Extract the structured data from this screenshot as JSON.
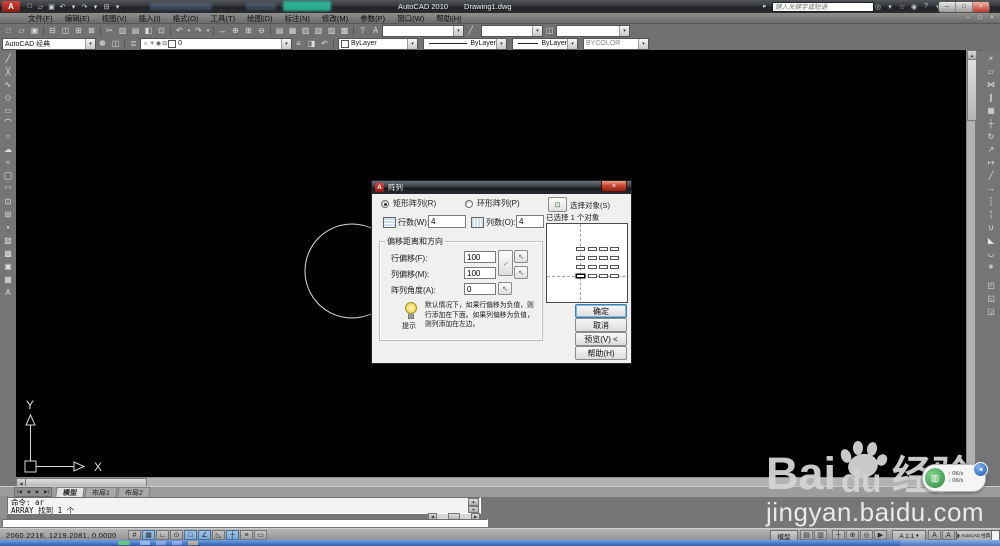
{
  "icons": {
    "combo_arrow": "▾",
    "expand": "▸",
    "up": "▲",
    "down": "▼",
    "left": "◀",
    "right": "▶",
    "acad_mini": "A",
    "pick": "↖",
    "pick_both": "↔",
    "select_objects": "⊡",
    "net_drum": "▥",
    "net_badge": "◄",
    "gear": "☸",
    "ui_icon": "◫",
    "layer_mgr": "≣"
  },
  "titlebar": {
    "logo": "A",
    "app_title": "AutoCAD 2010",
    "doc_title": "Drawing1.dwg",
    "search_placeholder": "键入关键字或短语",
    "qat_icons": [
      {
        "name": "new-icon",
        "glyph": "□"
      },
      {
        "name": "open-icon",
        "glyph": "▱"
      },
      {
        "name": "save-icon",
        "glyph": "▣"
      },
      {
        "name": "undo-icon",
        "glyph": "↶"
      },
      {
        "name": "undo-caret-icon",
        "glyph": "▾"
      },
      {
        "name": "redo-icon",
        "glyph": "↷"
      },
      {
        "name": "redo-caret-icon",
        "glyph": "▾"
      },
      {
        "name": "plot-icon",
        "glyph": "⊟"
      },
      {
        "name": "qat-caret-icon",
        "glyph": "▾"
      }
    ],
    "infocenter_icons": [
      {
        "name": "binoculars-icon",
        "glyph": "◎"
      },
      {
        "name": "search-caret-icon",
        "glyph": "▾"
      },
      {
        "name": "subscription-icon",
        "glyph": "☆"
      },
      {
        "name": "communication-icon",
        "glyph": "◉"
      },
      {
        "name": "help-icon",
        "glyph": "?"
      },
      {
        "name": "help-caret-icon",
        "glyph": "▾"
      }
    ],
    "window_buttons": [
      {
        "name": "minimize-button",
        "glyph": "─"
      },
      {
        "name": "restore-button",
        "glyph": "□"
      },
      {
        "name": "close-button",
        "glyph": "×"
      }
    ]
  },
  "menubar": {
    "items": [
      "文件(F)",
      "编辑(E)",
      "视图(V)",
      "插入(I)",
      "格式(O)",
      "工具(T)",
      "绘图(D)",
      "标注(N)",
      "修改(M)",
      "参数(P)",
      "窗口(W)",
      "帮助(H)"
    ],
    "doc_buttons": [
      {
        "name": "doc-minimize-button",
        "glyph": "─"
      },
      {
        "name": "doc-restore-button",
        "glyph": "□"
      },
      {
        "name": "doc-close-button",
        "glyph": "×"
      }
    ]
  },
  "toolbar1": {
    "icons": [
      {
        "name": "new-icon",
        "glyph": "□"
      },
      {
        "name": "open-icon",
        "glyph": "▱"
      },
      {
        "name": "save-icon",
        "glyph": "▣"
      },
      {
        "name": "separator",
        "glyph": "",
        "cls": "sepi",
        "inter": "false"
      },
      {
        "name": "plot-icon",
        "glyph": "⊟"
      },
      {
        "name": "plot-preview-icon",
        "glyph": "◫"
      },
      {
        "name": "publish-icon",
        "glyph": "⊞"
      },
      {
        "name": "export-dwf-icon",
        "glyph": "⊠"
      },
      {
        "name": "separator",
        "glyph": "",
        "cls": "sepi",
        "inter": "false"
      },
      {
        "name": "cut-icon",
        "glyph": "✂"
      },
      {
        "name": "copy-icon",
        "glyph": "▥"
      },
      {
        "name": "paste-icon",
        "glyph": "▤"
      },
      {
        "name": "match-properties-icon",
        "glyph": "◧"
      },
      {
        "name": "block-editor-icon",
        "glyph": "⊡"
      },
      {
        "name": "separator",
        "glyph": "",
        "cls": "sepi",
        "inter": "false"
      },
      {
        "name": "undo-icon",
        "glyph": "↶"
      },
      {
        "name": "undo-caret-icon",
        "glyph": "▾",
        "cls": "narrow"
      },
      {
        "name": "redo-icon",
        "glyph": "↷"
      },
      {
        "name": "redo-caret-icon",
        "glyph": "▾",
        "cls": "narrow"
      },
      {
        "name": "separator",
        "glyph": "",
        "cls": "sepi",
        "inter": "false"
      },
      {
        "name": "pan-icon",
        "glyph": "↔"
      },
      {
        "name": "zoom-realtime-icon",
        "glyph": "⊕"
      },
      {
        "name": "zoom-window-icon",
        "glyph": "⊞"
      },
      {
        "name": "zoom-previous-icon",
        "glyph": "⊖"
      },
      {
        "name": "separator",
        "glyph": "",
        "cls": "sepi",
        "inter": "false"
      },
      {
        "name": "properties-icon",
        "glyph": "▤"
      },
      {
        "name": "designcenter-icon",
        "glyph": "▦"
      },
      {
        "name": "tool-palettes-icon",
        "glyph": "▥"
      },
      {
        "name": "sheet-set-manager-icon",
        "glyph": "▧"
      },
      {
        "name": "markup-icon",
        "glyph": "▨"
      },
      {
        "name": "quickcalc-icon",
        "glyph": "▩"
      },
      {
        "name": "separator",
        "glyph": "",
        "cls": "sepi",
        "inter": "false"
      },
      {
        "name": "help-icon",
        "glyph": "?"
      }
    ],
    "style_icon": "A",
    "brush_icon": "╱"
  },
  "toolbar2": {
    "workspace_value": "AutoCAD 经典",
    "layer_icons": [
      {
        "name": "layer-on-icon",
        "glyph": "☼"
      },
      {
        "name": "layer-freeze-icon",
        "glyph": "☀"
      },
      {
        "name": "layer-lock-icon",
        "glyph": "◉"
      },
      {
        "name": "layer-plot-icon",
        "glyph": "⊟"
      }
    ],
    "layer_value": "0",
    "layer_tool_icons": [
      {
        "name": "layer-states-icon",
        "glyph": "≡"
      },
      {
        "name": "make-layer-current-icon",
        "glyph": "◨"
      },
      {
        "name": "layer-previous-icon",
        "glyph": "↶"
      }
    ],
    "color_value": "ByLayer",
    "linetype_value": "ByLayer",
    "lineweight_value": "ByLayer",
    "plotstyle_value": "BYCOLOR"
  },
  "draw_toolbar": [
    {
      "name": "line-icon",
      "glyph": "╱"
    },
    {
      "name": "construction-line-icon",
      "glyph": "╳"
    },
    {
      "name": "polyline-icon",
      "glyph": "∿"
    },
    {
      "name": "polygon-icon",
      "glyph": "◇"
    },
    {
      "name": "rectangle-icon",
      "glyph": "▭"
    },
    {
      "name": "arc-icon",
      "glyph": "⌒"
    },
    {
      "name": "circle-icon",
      "glyph": "○"
    },
    {
      "name": "revision-cloud-icon",
      "glyph": "☁"
    },
    {
      "name": "spline-icon",
      "glyph": "≈"
    },
    {
      "name": "ellipse-icon",
      "glyph": "◯"
    },
    {
      "name": "ellipse-arc-icon",
      "glyph": "◠"
    },
    {
      "name": "insert-block-icon",
      "glyph": "⊡"
    },
    {
      "name": "make-block-icon",
      "glyph": "⊞"
    },
    {
      "name": "point-icon",
      "glyph": "•"
    },
    {
      "name": "hatch-icon",
      "glyph": "▨"
    },
    {
      "name": "gradient-icon",
      "glyph": "▩"
    },
    {
      "name": "region-icon",
      "glyph": "▣"
    },
    {
      "name": "table-icon",
      "glyph": "▦"
    },
    {
      "name": "mtext-icon",
      "glyph": "A"
    }
  ],
  "modify_toolbar": [
    {
      "name": "erase-icon",
      "glyph": "×"
    },
    {
      "name": "copy-icon",
      "glyph": "▱"
    },
    {
      "name": "mirror-icon",
      "glyph": "⋈"
    },
    {
      "name": "offset-icon",
      "glyph": "∥"
    },
    {
      "name": "array-icon",
      "glyph": "▦"
    },
    {
      "name": "move-icon",
      "glyph": "┼"
    },
    {
      "name": "rotate-icon",
      "glyph": "↻"
    },
    {
      "name": "scale-icon",
      "glyph": "↗"
    },
    {
      "name": "stretch-icon",
      "glyph": "↦"
    },
    {
      "name": "trim-icon",
      "glyph": "╱"
    },
    {
      "name": "extend-icon",
      "glyph": "→"
    },
    {
      "name": "break-at-point-icon",
      "glyph": "┆"
    },
    {
      "name": "break-icon",
      "glyph": "╎"
    },
    {
      "name": "join-icon",
      "glyph": "∪"
    },
    {
      "name": "chamfer-icon",
      "glyph": "◣"
    },
    {
      "name": "fillet-icon",
      "glyph": "◡"
    },
    {
      "name": "explode-icon",
      "glyph": "∗"
    }
  ],
  "draworder_toolbar": [
    {
      "name": "bring-to-front-icon",
      "glyph": "◰"
    },
    {
      "name": "send-to-back-icon",
      "glyph": "◱"
    },
    {
      "name": "bring-above-icon",
      "glyph": "◲"
    }
  ],
  "dialog": {
    "title": "阵列",
    "radio_rect": "矩形阵列(R)",
    "radio_polar": "环形阵列(P)",
    "rows_label": "行数(W):",
    "rows_value": "4",
    "cols_label": "列数(O):",
    "cols_value": "4",
    "group_title": "偏移距离和方向",
    "row_offset_label": "行偏移(F):",
    "row_offset_value": "100",
    "col_offset_label": "列偏移(M):",
    "col_offset_value": "100",
    "angle_label": "阵列角度(A):",
    "angle_value": "0",
    "tip_label": "提示",
    "tip_text": "默认情况下，如果行偏移为负值，则行添加在下面。如果列偏移为负值，则列添加在左边。",
    "select_objects_label": "选择对象(S)",
    "selected_info": "已选择 1 个对象",
    "btn_ok": "确定",
    "btn_cancel": "取消",
    "btn_preview": "预览(V) <",
    "btn_help": "帮助(H)"
  },
  "ucs": {
    "x_label": "X",
    "y_label": "Y"
  },
  "tabs": {
    "nav": [
      {
        "name": "first-tab-button",
        "glyph": "|◀"
      },
      {
        "name": "prev-tab-button",
        "glyph": "◀"
      },
      {
        "name": "next-tab-button",
        "glyph": "▶"
      },
      {
        "name": "last-tab-button",
        "glyph": "▶|"
      }
    ],
    "items": [
      {
        "label": "模型",
        "cls": "active"
      },
      {
        "label": "布局1",
        "cls": ""
      },
      {
        "label": "布局2",
        "cls": ""
      }
    ]
  },
  "command": {
    "lines": [
      "命令: ar",
      "ARRAY 找到 1 个"
    ]
  },
  "statusbar": {
    "coords": "2060.2216, 1219.2081, 0.0000",
    "toggles": [
      {
        "name": "snap-toggle",
        "glyph": "#",
        "cls": ""
      },
      {
        "name": "grid-toggle",
        "glyph": "▦",
        "cls": "on"
      },
      {
        "name": "ortho-toggle",
        "glyph": "∟",
        "cls": ""
      },
      {
        "name": "polar-toggle",
        "glyph": "⊙",
        "cls": ""
      },
      {
        "name": "osnap-toggle",
        "glyph": "□",
        "cls": "on"
      },
      {
        "name": "otrack-toggle",
        "glyph": "∠",
        "cls": "on"
      },
      {
        "name": "ducs-toggle",
        "glyph": "◺",
        "cls": ""
      },
      {
        "name": "dyn-toggle",
        "glyph": "┼",
        "cls": "on"
      },
      {
        "name": "lwt-toggle",
        "glyph": "≡",
        "cls": ""
      },
      {
        "name": "qp-toggle",
        "glyph": "▭",
        "cls": ""
      }
    ],
    "model_label": "模型",
    "quickview_icons": [
      {
        "name": "quickview-layouts-icon",
        "glyph": "▤"
      },
      {
        "name": "quickview-drawings-icon",
        "glyph": "▥"
      }
    ],
    "nav_icons": [
      {
        "name": "pan-icon",
        "glyph": "┼"
      },
      {
        "name": "zoom-icon",
        "glyph": "⊕"
      },
      {
        "name": "steeringwheel-icon",
        "glyph": "◎"
      },
      {
        "name": "showmotion-icon",
        "glyph": "▶"
      }
    ],
    "scale_label": "A 1:1",
    "annotation_icons": [
      {
        "name": "annotation-visibility-icon",
        "glyph": "A"
      },
      {
        "name": "autoscale-icon",
        "glyph": "A"
      }
    ],
    "workspace_label": "AutoCAD 经典"
  },
  "watermark": {
    "part1": "Bai",
    "part2": "du",
    "part3": "经验",
    "url": "jingyan.baidu.com"
  },
  "net_widget": {
    "up": "0K/s",
    "down": "0K/s"
  }
}
